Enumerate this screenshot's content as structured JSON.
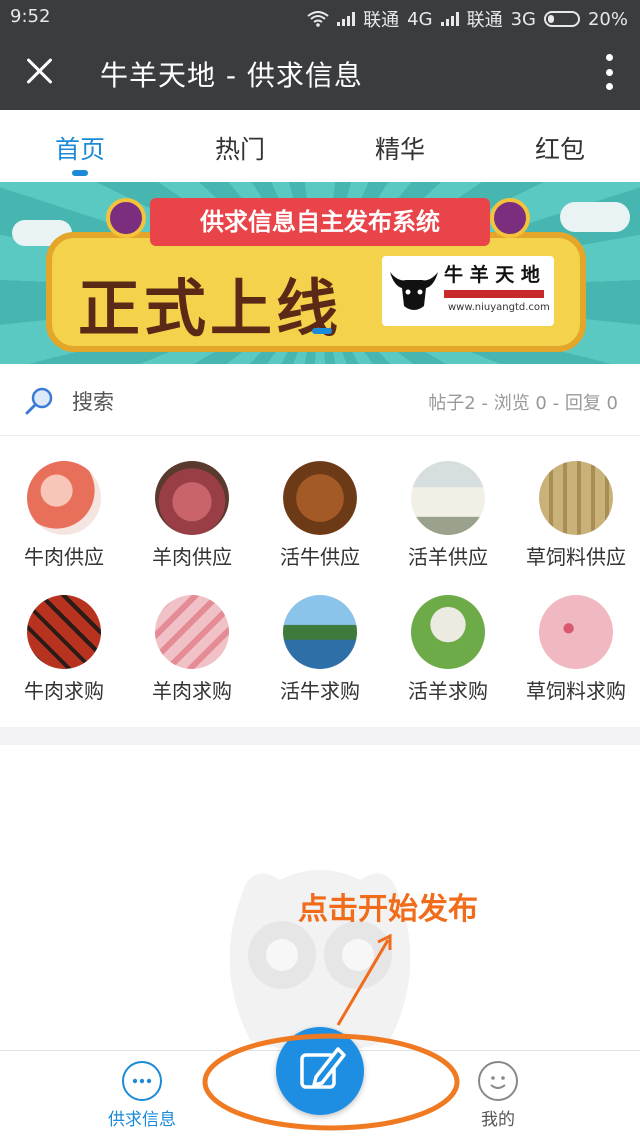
{
  "status_bar": {
    "time": "9:52",
    "carrier1": "联通",
    "net1": "4G",
    "carrier2": "联通",
    "net2": "3G",
    "battery": "20%"
  },
  "title_bar": {
    "title": "牛羊天地 - 供求信息"
  },
  "tabs": [
    {
      "label": "首页",
      "active": true
    },
    {
      "label": "热门",
      "active": false
    },
    {
      "label": "精华",
      "active": false
    },
    {
      "label": "红包",
      "active": false
    }
  ],
  "banner": {
    "ribbon": "供求信息自主发布系统",
    "headline": "正式上线",
    "logo_name": "牛 羊 天 地",
    "logo_url": "www.niuyangtd.com"
  },
  "search": {
    "label": "搜索",
    "stats": "帖子2 - 浏览 0 - 回复 0"
  },
  "categories": [
    {
      "label": "牛肉供应",
      "icon": "beef-supply-image"
    },
    {
      "label": "羊肉供应",
      "icon": "mutton-supply-image"
    },
    {
      "label": "活牛供应",
      "icon": "live-cattle-supply-image"
    },
    {
      "label": "活羊供应",
      "icon": "live-sheep-supply-image"
    },
    {
      "label": "草饲料供应",
      "icon": "forage-supply-image"
    },
    {
      "label": "牛肉求购",
      "icon": "beef-purchase-image"
    },
    {
      "label": "羊肉求购",
      "icon": "mutton-purchase-image"
    },
    {
      "label": "活牛求购",
      "icon": "live-cattle-purchase-image"
    },
    {
      "label": "活羊求购",
      "icon": "live-sheep-purchase-image"
    },
    {
      "label": "草饲料求购",
      "icon": "forage-purchase-image"
    }
  ],
  "hint": {
    "text": "点击开始发布"
  },
  "bottom_nav": {
    "left_label": "供求信息",
    "right_label": "我的",
    "accent": "#1b8ad8"
  }
}
